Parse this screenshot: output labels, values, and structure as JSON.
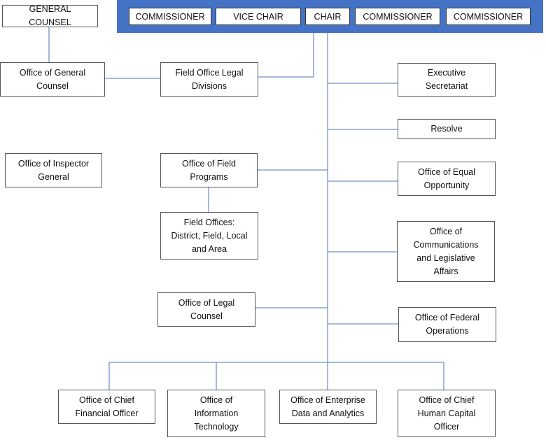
{
  "colors": {
    "board_bar": "#4472c4",
    "connector": "#7391c8"
  },
  "board": [
    "COMMISSIONER",
    "VICE CHAIR",
    "CHAIR",
    "COMMISSIONER",
    "COMMISSIONER"
  ],
  "general_counsel": "GENERAL COUNSEL",
  "units": {
    "ogc": "Office of General\nCounsel",
    "fold": "Field Office Legal\nDivisions",
    "exec": "Executive\nSecretariat",
    "resolve": "Resolve",
    "oig": "Office of Inspector\nGeneral",
    "ofp": "Office of Field\nPrograms",
    "oeo": "Office of Equal\nOpportunity",
    "fo": "Field Offices:\nDistrict, Field, Local\nand Area",
    "ocla": "Office of\nCommunications\nand Legislative\nAffairs",
    "olc": "Office of Legal\nCounsel",
    "ofo": "Office of Federal\nOperations",
    "cfo": "Office of Chief\nFinancial Officer",
    "oit": "Office of\nInformation\nTechnology",
    "oeda": "Office of Enterprise\nData and Analytics",
    "hco": "Office of Chief\nHuman Capital\nOfficer"
  }
}
